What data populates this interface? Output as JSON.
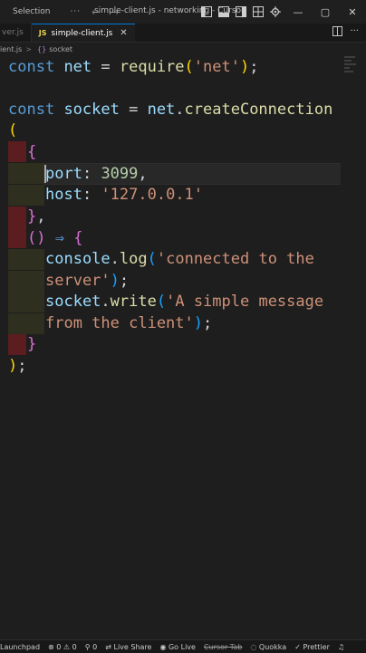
{
  "titlebar": {
    "menu": [
      "Selection"
    ],
    "more": "···",
    "back": "←",
    "forward": "→",
    "title": "simple-client.js - networking - Cursor",
    "minimize": "—",
    "maximize": "▢",
    "close": "✕"
  },
  "tabs": [
    {
      "label": "ver.js",
      "active": false
    },
    {
      "label": "simple-client.js",
      "active": true,
      "badge": "JS",
      "close": "✕"
    }
  ],
  "breadcrumb": {
    "file": "ient.js",
    "separator": ">",
    "symbol_icon": "{}",
    "symbol": "socket"
  },
  "code": {
    "line1": {
      "kw": "const",
      "name": "net",
      "op": " = ",
      "fn": "require",
      "open": "(",
      "str": "'net'",
      "close": ")",
      "end": ";"
    },
    "line3": {
      "kw": "const",
      "name": "socket",
      "op": " = ",
      "obj": "net",
      "dot": ".",
      "fn": "createConnection"
    },
    "line4": {
      "paren": "("
    },
    "line5": {
      "brace": "{"
    },
    "line6": {
      "key": "port",
      "colon": ": ",
      "num": "3099",
      "comma": ","
    },
    "line7": {
      "key": "host",
      "colon": ": ",
      "str": "'127.0.0.1'"
    },
    "line8": {
      "brace": "}",
      "comma": ","
    },
    "line9": {
      "parens": "()",
      "arrow": " ⇒ ",
      "brace": "{"
    },
    "line10": {
      "obj": "console",
      "dot": ".",
      "fn": "log",
      "open": "(",
      "str": "'connected to the"
    },
    "line11": {
      "str": "server'",
      "close": ")",
      "end": ";"
    },
    "line12": {
      "obj": "socket",
      "dot": ".",
      "fn": "write",
      "open": "(",
      "str": "'A simple message"
    },
    "line13": {
      "str": "from the client'",
      "close": ")",
      "end": ";"
    },
    "line14": {
      "brace": "}"
    },
    "line15": {
      "close": ")",
      "end": ";"
    }
  },
  "statusbar": {
    "launchpad": "Launchpad",
    "errors": "0",
    "warnings": "0",
    "ports": "0",
    "live_share": "Live Share",
    "go_live": "Go Live",
    "cursor_tab": "Cursor Tab",
    "quokka": "Quokka",
    "prettier": "Prettier"
  },
  "colors": {
    "keyword": "#569cd6",
    "variable": "#9cdcfe",
    "function": "#dcdcaa",
    "string": "#ce9178",
    "number": "#b5cea8",
    "bracket_gold": "#ffd700",
    "bracket_purple": "#da70d6",
    "bracket_blue": "#179fff"
  }
}
